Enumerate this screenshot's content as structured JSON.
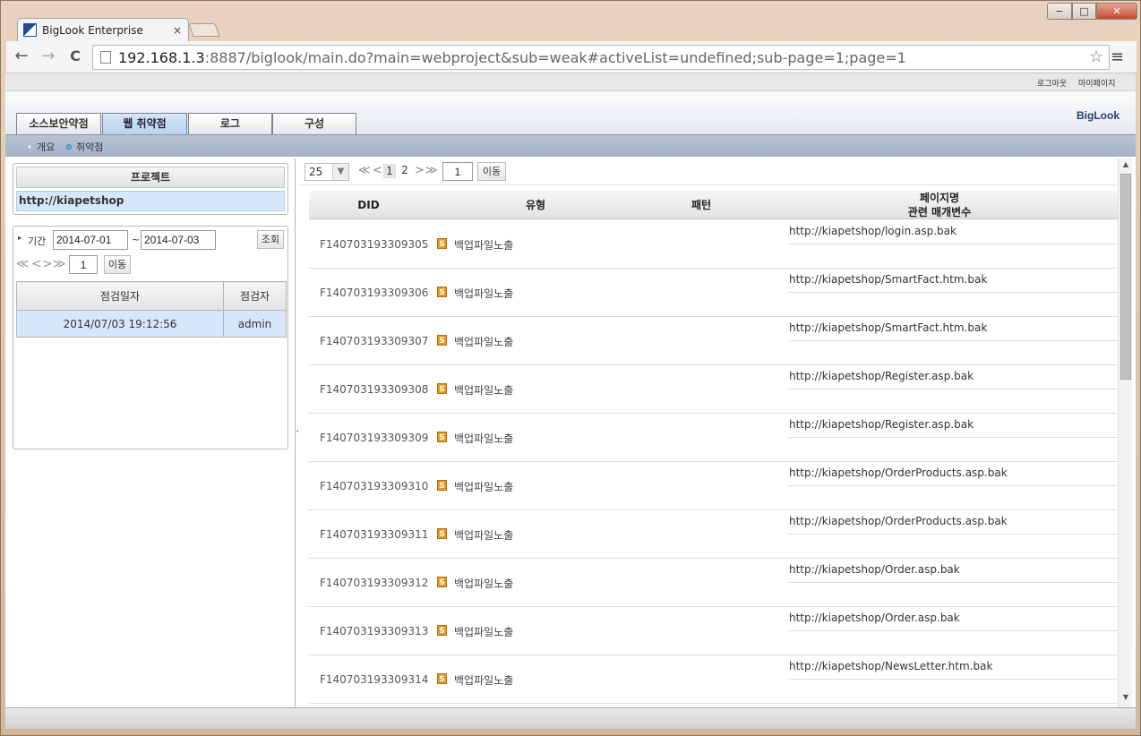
{
  "browser": {
    "tab_title": "BigLook Enterprise",
    "tab_close": "×",
    "url_host": "192.168.1.3",
    "url_rest": ":8887/biglook/main.do?main=webproject&sub=weak#activeList=undefined;sub-page=1;page=1",
    "back": "←",
    "forward": "→",
    "reload": "C",
    "star": "☆",
    "menu": "≡",
    "win_min": "−",
    "win_max": "□",
    "win_close": "✕"
  },
  "util": {
    "logout": "로그아웃",
    "mypage": "마이페이지"
  },
  "main_tabs": [
    {
      "label": "소스보안약점"
    },
    {
      "label": "웹 취약점"
    },
    {
      "label": "로그"
    },
    {
      "label": "구성"
    }
  ],
  "brand": "BigLook",
  "sub_tabs": [
    {
      "label": "개요"
    },
    {
      "label": "취약점"
    }
  ],
  "project": {
    "header": "프로젝트",
    "name": "http://kiapetshop"
  },
  "period": {
    "label": "기간",
    "from": "2014-07-01",
    "sep": "~",
    "to": "2014-07-03",
    "search_btn": "조회",
    "page_input": "1",
    "go_btn": "이동",
    "first": "≪",
    "prev": "<",
    "next": ">",
    "last": "≫"
  },
  "check_table": {
    "col_date": "점검일자",
    "col_user": "점검자",
    "rows": [
      {
        "date": "2014/07/03 19:12:56",
        "user": "admin"
      }
    ]
  },
  "list": {
    "page_size": "25",
    "pages": [
      "1",
      "2"
    ],
    "page_input": "1",
    "go_btn": "이동",
    "col_did": "DID",
    "col_type": "유형",
    "col_pattern": "패턴",
    "col_page_l1": "페이지명",
    "col_page_l2": "관련 매개변수",
    "type_badge": "S",
    "rows": [
      {
        "did": "F140703193309305",
        "type": "백업파일노출",
        "url": "http://kiapetshop/login.asp.bak"
      },
      {
        "did": "F140703193309306",
        "type": "백업파일노출",
        "url": "http://kiapetshop/SmartFact.htm.bak"
      },
      {
        "did": "F140703193309307",
        "type": "백업파일노출",
        "url": "http://kiapetshop/SmartFact.htm.bak"
      },
      {
        "did": "F140703193309308",
        "type": "백업파일노출",
        "url": "http://kiapetshop/Register.asp.bak"
      },
      {
        "did": "F140703193309309",
        "type": "백업파일노출",
        "url": "http://kiapetshop/Register.asp.bak"
      },
      {
        "did": "F140703193309310",
        "type": "백업파일노출",
        "url": "http://kiapetshop/OrderProducts.asp.bak"
      },
      {
        "did": "F140703193309311",
        "type": "백업파일노출",
        "url": "http://kiapetshop/OrderProducts.asp.bak"
      },
      {
        "did": "F140703193309312",
        "type": "백업파일노출",
        "url": "http://kiapetshop/Order.asp.bak"
      },
      {
        "did": "F140703193309313",
        "type": "백업파일노출",
        "url": "http://kiapetshop/Order.asp.bak"
      },
      {
        "did": "F140703193309314",
        "type": "백업파일노출",
        "url": "http://kiapetshop/NewsLetter.htm.bak"
      }
    ]
  }
}
